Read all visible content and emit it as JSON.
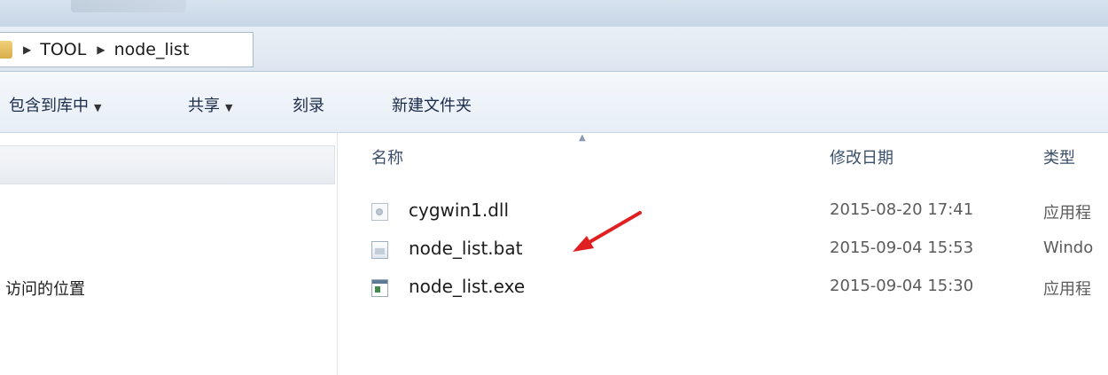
{
  "address_bar": {
    "crumbs": [
      "TOOL",
      "node_list"
    ]
  },
  "toolbar": {
    "include_library_label": "包含到库中",
    "share_label": "共享",
    "burn_label": "刻录",
    "new_folder_label": "新建文件夹"
  },
  "nav_pane": {
    "items": [
      {
        "label": "访问的位置"
      }
    ]
  },
  "file_list": {
    "columns": {
      "name": "名称",
      "modified": "修改日期",
      "type": "类型"
    },
    "files": [
      {
        "name": "cygwin1.dll",
        "modified": "2015-08-20 17:41",
        "type": "应用程",
        "icon": "dll-file-icon"
      },
      {
        "name": "node_list.bat",
        "modified": "2015-09-04 15:53",
        "type": "Windo",
        "icon": "bat-file-icon"
      },
      {
        "name": "node_list.exe",
        "modified": "2015-09-04 15:30",
        "type": "应用程",
        "icon": "exe-file-icon"
      }
    ]
  },
  "annotation": {
    "arrow_color": "#e02020"
  }
}
